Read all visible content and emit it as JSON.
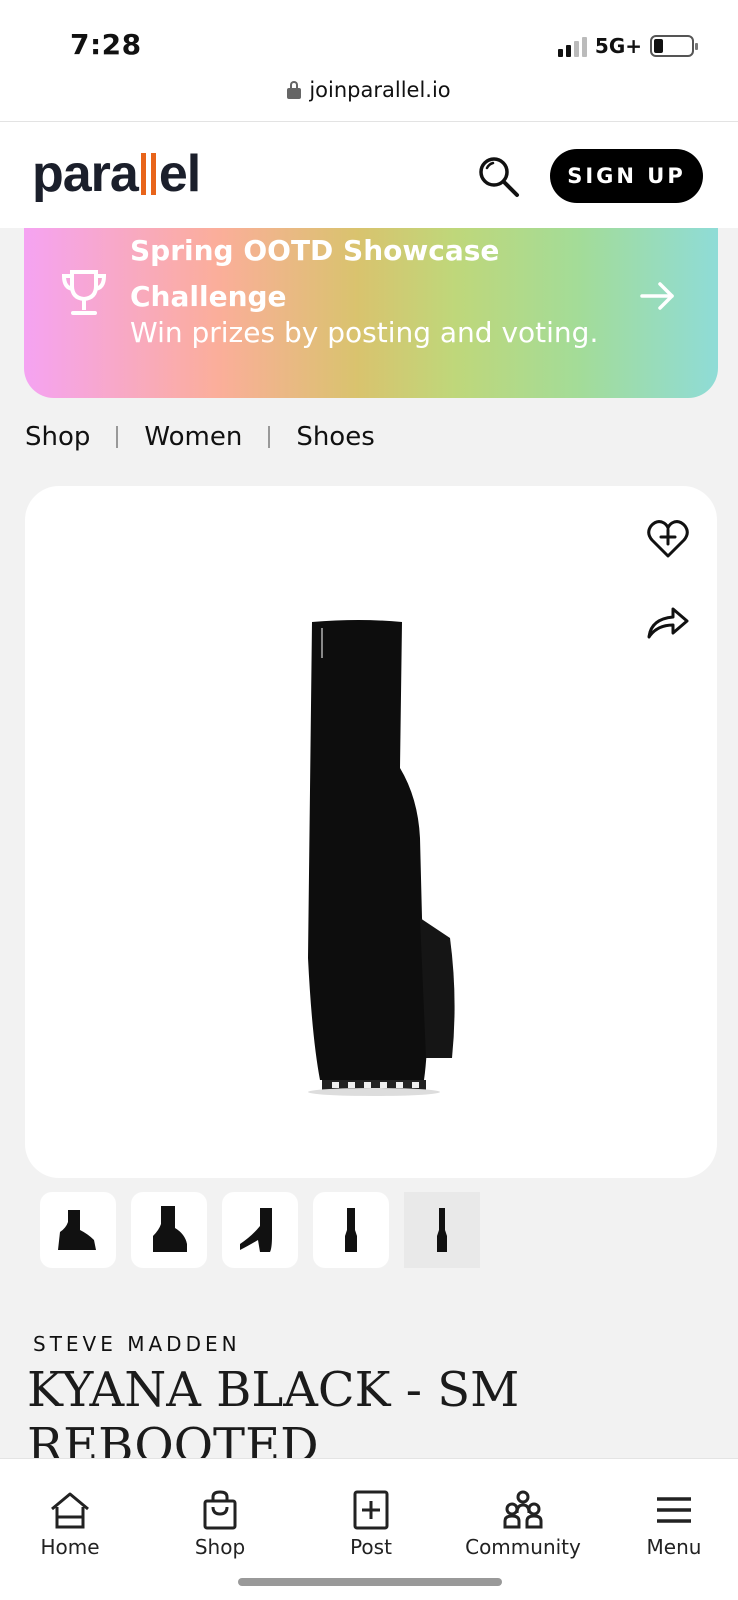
{
  "status_bar": {
    "time": "7:28",
    "network": "5G+",
    "url": "joinparallel.io"
  },
  "header": {
    "logo_text": "parallel",
    "logo_accent": "#e8641a",
    "signup_label": "SIGN UP",
    "search_icon": "search-icon"
  },
  "banner": {
    "title": "Spring OOTD Showcase Challenge",
    "subtitle": "Win prizes by posting and voting.",
    "icon": "trophy-icon"
  },
  "breadcrumb": [
    "Shop",
    "Women",
    "Shoes"
  ],
  "product": {
    "brand": "STEVE MADDEN",
    "name": "KYANA BLACK - SM REBOOTED",
    "thumbnails": 5,
    "selected_thumbnail": 5
  },
  "bottom_nav": [
    {
      "label": "Home",
      "icon": "home-icon"
    },
    {
      "label": "Shop",
      "icon": "shopping-bag-icon"
    },
    {
      "label": "Post",
      "icon": "plus-square-icon"
    },
    {
      "label": "Community",
      "icon": "community-icon"
    },
    {
      "label": "Menu",
      "icon": "menu-icon"
    }
  ]
}
